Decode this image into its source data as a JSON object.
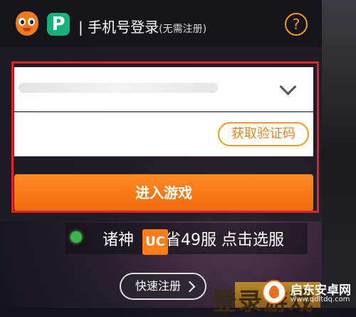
{
  "header": {
    "title": "手机号登录",
    "subtitle": "(无需注册)",
    "separator": "|",
    "help_icon": "?",
    "logo_letter": "P"
  },
  "form": {
    "phone_placeholder": "",
    "code_placeholder": "",
    "get_code_label": "获取验证码",
    "submit_label": "进入游戏"
  },
  "server": {
    "text": "诸神　　省49服 点击选服",
    "badge": "UC"
  },
  "quick_register_label": "快速注册",
  "background_text": "登录游戏",
  "watermark": {
    "name": "启东安卓网",
    "url": "www.qdltdq.com"
  },
  "colors": {
    "accent": "#f26b0a",
    "highlight_frame": "#e3232b",
    "brand_green": "#17b07a",
    "server_status": "#39b54a"
  }
}
